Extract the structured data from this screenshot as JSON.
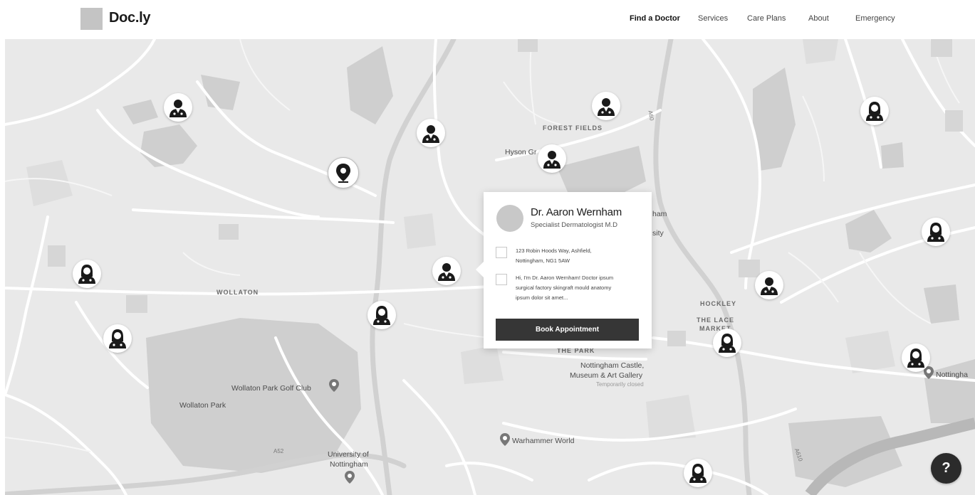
{
  "brand": {
    "name": "Doc.ly"
  },
  "nav": {
    "items": [
      {
        "label": "Find a Doctor",
        "active": true
      },
      {
        "label": "Services"
      },
      {
        "label": "Care Plans"
      },
      {
        "label": "About"
      },
      {
        "label": "Emergency"
      }
    ]
  },
  "map": {
    "labels": {
      "forest_fields": "FOREST FIELDS",
      "hyson_green": "Hyson Gr",
      "wollaton": "WOLLATON",
      "wollaton_golf": "Wollaton Park Golf Club",
      "wollaton_park": "Wollaton Park",
      "university_1": "University of",
      "university_2": "Nottingham",
      "warhammer": "Warhammer World",
      "castle_1": "Nottingham Castle,",
      "castle_2": "Museum & Art Gallery",
      "castle_status": "Temporarily closed",
      "the_park": "THE PARK",
      "hockley": "HOCKLEY",
      "lace_1": "THE LACE",
      "lace_2": "MARKET",
      "nottingham_edge": "Nottingha",
      "ham_fragment": "ham",
      "sity_fragment": "sity",
      "a52": "A52",
      "a60": "A60",
      "a610": "A610"
    }
  },
  "doctor_card": {
    "name": "Dr. Aaron Wernham",
    "specialty": "Specialist Dermatologist M.D",
    "address_line1": "123 Robin Hoods Way, Ashfield,",
    "address_line2": "Nottingham, NG1 5AW",
    "bio_line1": "Hi, I'm Dr. Aaron Wernham! Doctor ipsum",
    "bio_line2": "surgical factory skingraft mould anatomy",
    "bio_line3": "ipsum dolor sit amet...",
    "book_label": "Book Appointment"
  },
  "help": {
    "label": "?"
  },
  "colors": {
    "map_bg": "#e9e9e9",
    "park": "#c9c9c9",
    "water": "#b0b0b0",
    "road": "#ffffff",
    "major_road": "#d3d3d3",
    "button": "#363636"
  }
}
